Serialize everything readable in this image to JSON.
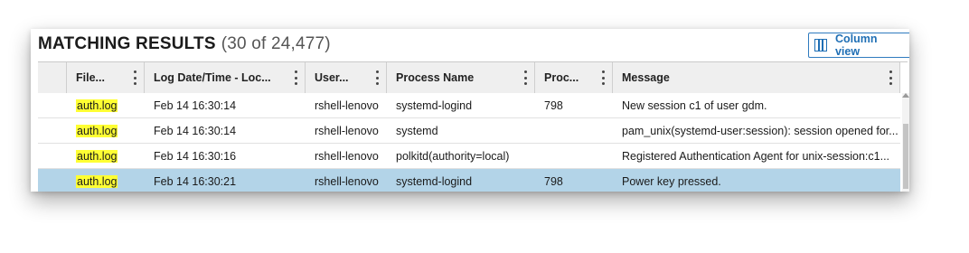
{
  "header": {
    "title": "MATCHING RESULTS",
    "count": "(30 of 24,477)",
    "column_view_label": "Column view"
  },
  "columns": [
    {
      "label": ""
    },
    {
      "label": "File..."
    },
    {
      "label": "Log Date/Time - Loc..."
    },
    {
      "label": "User..."
    },
    {
      "label": "Process Name"
    },
    {
      "label": "Proc..."
    },
    {
      "label": "Message"
    }
  ],
  "rows": [
    {
      "file": "auth.log",
      "datetime": "Feb 14 16:30:14",
      "user": "rshell-lenovo",
      "process": "systemd-logind",
      "pid": "798",
      "message": "New session c1 of user gdm.",
      "selected": false
    },
    {
      "file": "auth.log",
      "datetime": "Feb 14 16:30:14",
      "user": "rshell-lenovo",
      "process": "systemd",
      "pid": "",
      "message": "pam_unix(systemd-user:session): session opened for...",
      "selected": false
    },
    {
      "file": "auth.log",
      "datetime": "Feb 14 16:30:16",
      "user": "rshell-lenovo",
      "process": "polkitd(authority=local)",
      "pid": "",
      "message": "Registered Authentication Agent for unix-session:c1...",
      "selected": false
    },
    {
      "file": "auth.log",
      "datetime": "Feb 14 16:30:21",
      "user": "rshell-lenovo",
      "process": "systemd-logind",
      "pid": "798",
      "message": "Power key pressed.",
      "selected": true
    }
  ],
  "colors": {
    "accent": "#1f6fb5",
    "selected_row": "#b3d4e8",
    "highlight": "#ffff33"
  },
  "icons": [
    "column-view-icon",
    "chevron-down-icon",
    "kebab-menu-icon",
    "scroll-up-icon"
  ]
}
